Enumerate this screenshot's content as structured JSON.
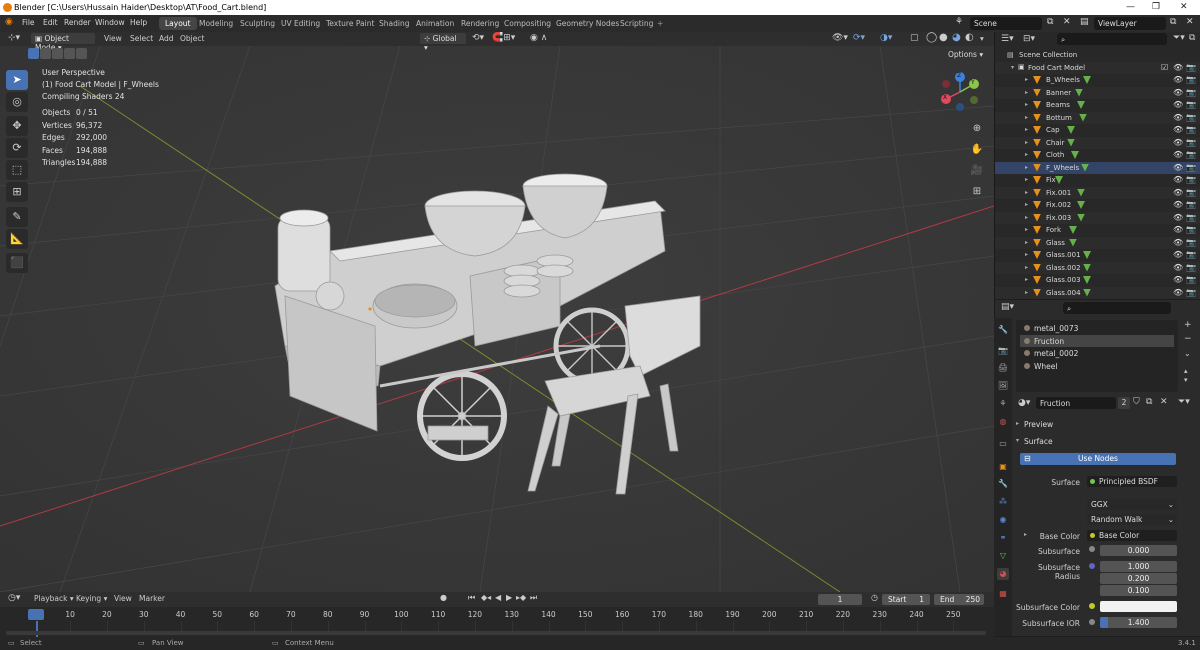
{
  "window": {
    "title": "Blender [C:\\Users\\Hussain Haider\\Desktop\\AT\\Food_Cart.blend]",
    "minimize": "—",
    "maximize": "❐",
    "close": "✕"
  },
  "menu": {
    "items": [
      "File",
      "Edit",
      "Render",
      "Window",
      "Help"
    ],
    "workspaces": [
      "Layout",
      "Modeling",
      "Sculpting",
      "UV Editing",
      "Texture Paint",
      "Shading",
      "Animation",
      "Rendering",
      "Compositing",
      "Geometry Nodes",
      "Scripting"
    ],
    "active_workspace": "Layout",
    "add_tab": "+",
    "scene": "Scene",
    "view_layer": "ViewLayer"
  },
  "viewport_header": {
    "mode": "Object Mode",
    "menus": [
      "View",
      "Select",
      "Add",
      "Object"
    ],
    "transform": "Global",
    "options": "Options"
  },
  "viewport_info": {
    "perspective": "User Perspective",
    "selection": "(1) Food Cart Model | F_Wheels",
    "compiling": "Compiling Shaders 24",
    "stats": [
      {
        "label": "Objects",
        "value": "0 / 51"
      },
      {
        "label": "Vertices",
        "value": "96,372"
      },
      {
        "label": "Edges",
        "value": "292,000"
      },
      {
        "label": "Faces",
        "value": "194,888"
      },
      {
        "label": "Triangles",
        "value": "194,888"
      }
    ]
  },
  "gizmo": {
    "x": "X",
    "y": "Y",
    "z": "Z"
  },
  "outliner": {
    "root": "Scene Collection",
    "collection": "Food Cart Model",
    "items": [
      "B_Wheels",
      "Banner",
      "Beams",
      "Bottum",
      "Cap",
      "Chair",
      "Cloth",
      "F_Wheels",
      "Fix",
      "Fix.001",
      "Fix.002",
      "Fix.003",
      "Fork",
      "Glass",
      "Glass.001",
      "Glass.002",
      "Glass.003",
      "Glass.004"
    ],
    "selected": "F_Wheels"
  },
  "properties": {
    "materials": [
      "metal_0073",
      "Fruction",
      "metal_0002",
      "Wheel"
    ],
    "active_material": "Fruction",
    "material_name": "Fruction",
    "user_count": "2",
    "sections": {
      "preview": "Preview",
      "surface": "Surface"
    },
    "use_nodes": "Use Nodes",
    "surface_label": "Surface",
    "surface_value": "Principled BSDF",
    "distribution": "GGX",
    "subsurface_method": "Random Walk",
    "base_color_label": "Base Color",
    "base_color_value": "Base Color",
    "subsurface_label": "Subsurface",
    "subsurface_value": "0.000",
    "subsurface_radius_label": "Subsurface Radius",
    "subsurface_radius": [
      "1.000",
      "0.200",
      "0.100"
    ],
    "subsurface_color_label": "Subsurface Color",
    "subsurface_ior_label": "Subsurface IOR",
    "subsurface_ior_value": "1.400"
  },
  "timeline": {
    "menus": [
      "Playback",
      "Keying",
      "View",
      "Marker"
    ],
    "current_frame": "1",
    "start_label": "Start",
    "start": "1",
    "end_label": "End",
    "end": "250",
    "frames": [
      "1",
      "10",
      "20",
      "30",
      "40",
      "50",
      "60",
      "70",
      "80",
      "90",
      "100",
      "110",
      "120",
      "130",
      "140",
      "150",
      "160",
      "170",
      "180",
      "190",
      "200",
      "210",
      "220",
      "230",
      "240",
      "250"
    ]
  },
  "statusbar": {
    "select": "Select",
    "pan": "Pan View",
    "context": "Context Menu",
    "version": "3.4.1"
  },
  "colors": {
    "accent": "#4772b3",
    "object_icon": "#e8901c",
    "mesh_icon": "#6fc84f",
    "axis_x": "#e04a5f",
    "axis_y": "#8bc44a",
    "axis_z": "#3b82e0"
  }
}
